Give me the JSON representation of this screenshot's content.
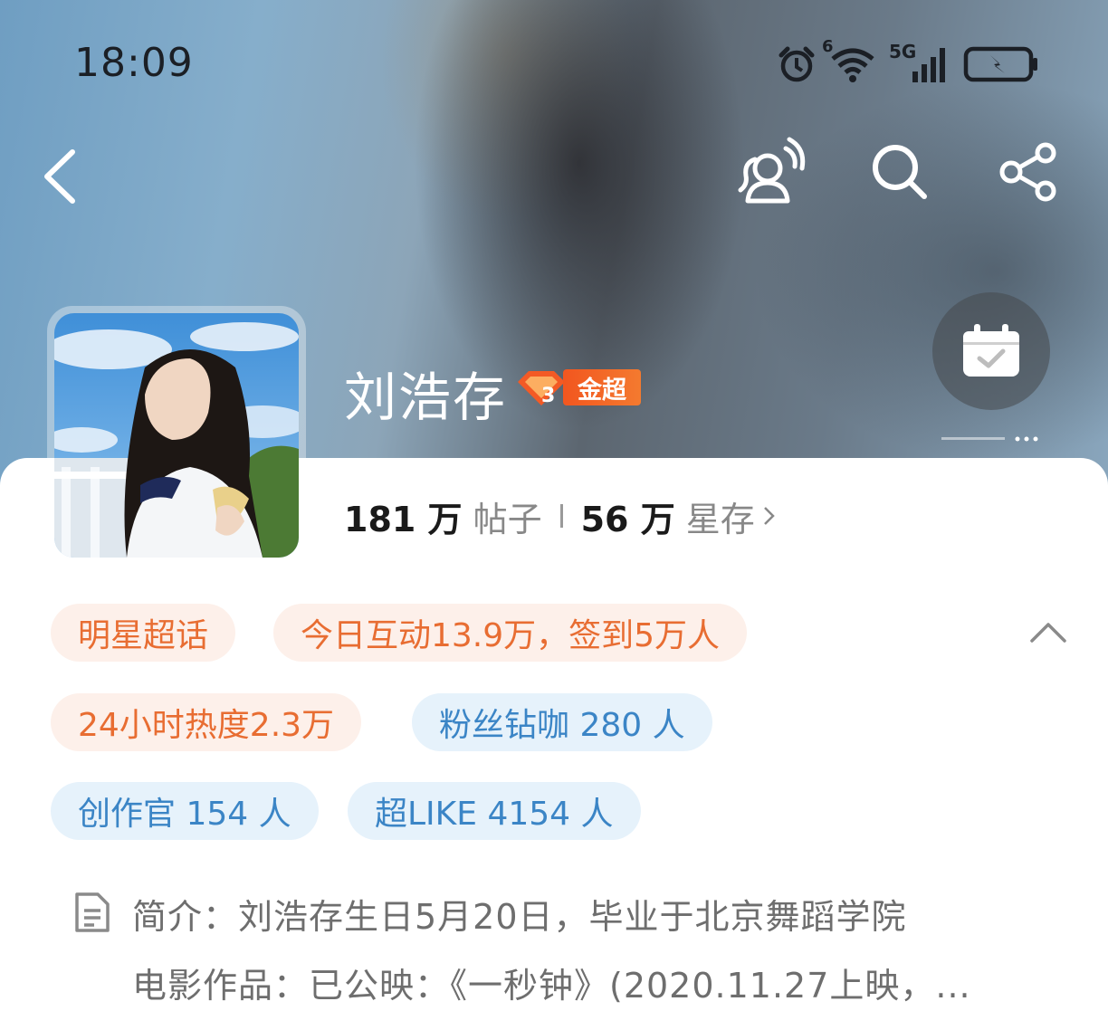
{
  "status_bar": {
    "time": "18:09",
    "icons": [
      "alarm-icon",
      "wifi-icon",
      "signal-5g-icon",
      "battery-charging-icon"
    ],
    "wifi_label": "6",
    "network_label": "5G"
  },
  "nav": {
    "icons": [
      "back-icon",
      "fans-icon",
      "search-icon",
      "share-icon"
    ]
  },
  "topic": {
    "name": "刘浩存",
    "badge_text": "金超",
    "badge_level": "3",
    "posts_count": "181 万",
    "posts_label": "帖子",
    "fans_count": "56 万",
    "fans_label": "星存"
  },
  "tags": [
    {
      "text": "明星超话",
      "style": "orange"
    },
    {
      "text": "今日互动13.9万，签到5万人",
      "style": "orange"
    },
    {
      "text": "24小时热度2.3万",
      "style": "orange"
    },
    {
      "text": "粉丝钻咖 280 人",
      "style": "blue"
    },
    {
      "text": "创作官 154 人",
      "style": "blue"
    },
    {
      "text": "超LIKE 4154 人",
      "style": "blue"
    }
  ],
  "intro": {
    "line1": "简介：刘浩存生日5月20日，毕业于北京舞蹈学院",
    "line2": "电影作品：已公映：《一秒钟》(2020.11.27上映，..."
  },
  "colors": {
    "orange_tag_bg": "#fdf0ea",
    "orange_tag_text": "#e86d32",
    "blue_tag_bg": "#e6f2fb",
    "blue_tag_text": "#3b85c6",
    "badge": "#f2561f"
  }
}
